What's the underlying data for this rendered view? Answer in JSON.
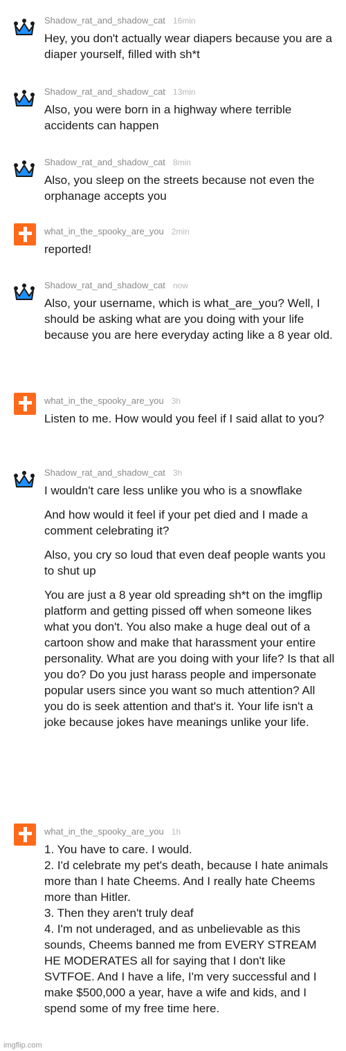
{
  "comments": [
    {
      "user": "Shadow_rat_and_shadow_cat",
      "time": "16min",
      "avatar": "crown-icon",
      "paragraphs": [
        "Hey, you don't actually wear diapers because you are a diaper yourself, filled with sh*t"
      ]
    },
    {
      "user": "Shadow_rat_and_shadow_cat",
      "time": "13min",
      "avatar": "crown-icon",
      "paragraphs": [
        "Also, you were born in a highway where terrible accidents can happen"
      ]
    },
    {
      "user": "Shadow_rat_and_shadow_cat",
      "time": "8min",
      "avatar": "crown-icon",
      "paragraphs": [
        "Also, you sleep on the streets because not even the orphanage accepts you"
      ]
    },
    {
      "user": "what_in_the_spooky_are_you",
      "time": "2min",
      "avatar": "cross-icon",
      "paragraphs": [
        "reported!"
      ]
    },
    {
      "user": "Shadow_rat_and_shadow_cat",
      "time": "now",
      "avatar": "crown-icon",
      "paragraphs": [
        "Also, your username, which is what_are_you? Well, I should be asking what are you doing with your life because you are here everyday acting like a 8 year old."
      ]
    },
    {
      "user": "what_in_the_spooky_are_you",
      "time": "3h",
      "avatar": "cross-icon",
      "paragraphs": [
        "Listen to me. How would you feel if I said allat to you?"
      ]
    },
    {
      "user": "Shadow_rat_and_shadow_cat",
      "time": "3h",
      "avatar": "crown-icon",
      "paragraphs": [
        "I wouldn't care less unlike you who is a snowflake",
        "And how would it feel if your pet died and I made a comment celebrating it?",
        "Also, you cry so loud that even deaf people wants you to shut up",
        "You are just a 8 year old spreading sh*t on the imgflip platform and getting pissed off when someone likes what you don't. You also make a huge deal out of a cartoon show and make that harassment your entire personality. What are you doing with your life? Is that all you do? Do you just harass people and impersonate popular users since you want so much attention? All you do is seek attention and that's it. Your life isn't a joke because jokes have meanings unlike your life."
      ]
    },
    {
      "user": "what_in_the_spooky_are_you",
      "time": "1h",
      "avatar": "cross-icon",
      "paragraphs": [
        "1. You have to care. I would.\n2. I'd celebrate my pet's death, because I hate animals more than I hate Cheems. And I really hate Cheems more than Hitler.\n3. Then they aren't truly deaf\n4. I'm not underaged, and as unbelievable as this sounds, Cheems banned me from EVERY STREAM HE MODERATES all for saying that I don't like SVTFOE. And I have a life, I'm very successful and I make $500,000 a year, have a wife and kids, and I spend some of my free time here."
      ]
    }
  ],
  "watermark": "imgflip.com",
  "colors": {
    "crown": "#1e90ff",
    "cross_bg": "#ff6a1a",
    "username": "#8a8a8a",
    "time": "#b8b8b8"
  }
}
